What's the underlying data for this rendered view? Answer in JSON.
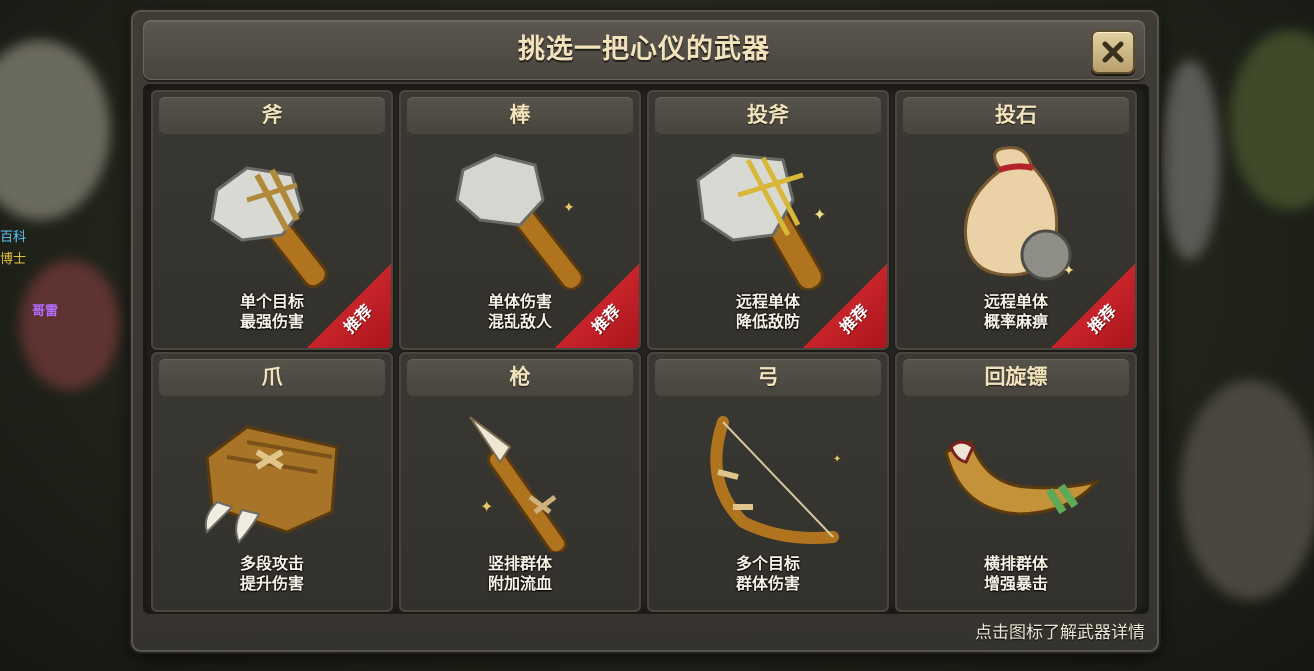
{
  "dialog": {
    "title": "挑选一把心仪的武器",
    "close_icon": "close-x-icon",
    "hint": "点击图标了解武器详情"
  },
  "background_text": {
    "left_1": "百科",
    "left_2": "博士",
    "left_3": "哥雷"
  },
  "weapons": [
    {
      "name": "斧",
      "desc1": "单个目标",
      "desc2": "最强伤害",
      "icon": "stone-axe-icon",
      "recommended": true,
      "badge": "推荐"
    },
    {
      "name": "棒",
      "desc1": "单体伤害",
      "desc2": "混乱敌人",
      "icon": "stone-club-icon",
      "recommended": true,
      "badge": "推荐"
    },
    {
      "name": "投斧",
      "desc1": "远程单体",
      "desc2": "降低敌防",
      "icon": "throwing-axe-icon",
      "recommended": true,
      "badge": "推荐"
    },
    {
      "name": "投石",
      "desc1": "远程单体",
      "desc2": "概率麻痹",
      "icon": "stone-sack-icon",
      "recommended": true,
      "badge": "推荐"
    },
    {
      "name": "爪",
      "desc1": "多段攻击",
      "desc2": "提升伤害",
      "icon": "claw-icon",
      "recommended": false
    },
    {
      "name": "枪",
      "desc1": "竖排群体",
      "desc2": "附加流血",
      "icon": "spear-icon",
      "recommended": false
    },
    {
      "name": "弓",
      "desc1": "多个目标",
      "desc2": "群体伤害",
      "icon": "bow-icon",
      "recommended": false
    },
    {
      "name": "回旋镖",
      "desc1": "横排群体",
      "desc2": "增强暴击",
      "icon": "boomerang-icon",
      "recommended": false
    }
  ],
  "colors": {
    "title_text": "#f3e3bd",
    "ribbon": "#c8242b",
    "panel": "#3a3833"
  }
}
